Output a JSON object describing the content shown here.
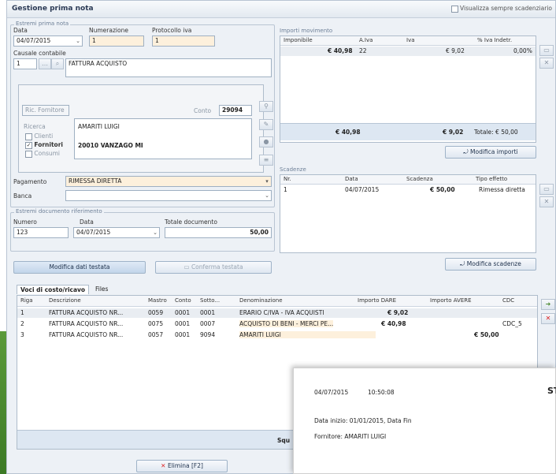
{
  "window": {
    "title": "Gestione prima nota",
    "show_due_dates_label": "Visualizza sempre scadenziario"
  },
  "header_group": {
    "legend": "Estremi prima nota",
    "date_label": "Data",
    "date_value": "04/07/2015",
    "numbering_label": "Numerazione",
    "numbering_value": "1",
    "vat_protocol_label": "Protocollo iva",
    "vat_protocol_value": "1",
    "causal_label": "Causale contabile",
    "causal_code": "1",
    "causal_desc": "FATTURA ACQUISTO"
  },
  "supplier": {
    "search_label": "Ric. Fornitore",
    "account_label": "Conto",
    "account_value": "29094",
    "search_group_label": "Ricerca",
    "filter_clients": "Clienti",
    "filter_suppliers": "Fornitori",
    "filter_consumers": "Consumi",
    "name": "AMARITI LUIGI",
    "address": "20010 VANZAGO  MI"
  },
  "payment": {
    "payment_label": "Pagamento",
    "payment_value": "RIMESSA DIRETTA",
    "bank_label": "Banca",
    "bank_value": ""
  },
  "document": {
    "legend": "Estremi documento riferimento",
    "number_label": "Numero",
    "number_value": "123",
    "date_label": "Data",
    "date_value": "04/07/2015",
    "total_label": "Totale documento",
    "total_value": "50,00"
  },
  "buttons": {
    "edit_header": "Modifica dati testata",
    "confirm_header": "Conferma testata",
    "edit_amounts": "Modifica importi",
    "edit_due_dates": "Modifica scadenze",
    "delete": "Elimina [F2]"
  },
  "amounts": {
    "legend": "Importi movimento",
    "columns": [
      "Imponibile",
      "A.Iva",
      "Iva",
      "% Iva Indetr."
    ],
    "row": {
      "taxable": "€ 40,98",
      "vat_code": "22",
      "vat": "€ 9,02",
      "nondeductible": "0,00%"
    },
    "total_taxable": "€ 40,98",
    "total_vat": "€ 9,02",
    "total_label": "Totale: € 50,00"
  },
  "due_dates": {
    "legend": "Scadenze",
    "columns": [
      "Nr.",
      "Data",
      "Scadenza",
      "Tipo effetto"
    ],
    "row": {
      "nr": "1",
      "date": "04/07/2015",
      "amount": "€ 50,00",
      "type": "Rimessa diretta"
    }
  },
  "tabs": [
    "Voci di costo/ricavo",
    "Files"
  ],
  "entries": {
    "columns": [
      "Riga",
      "Descrizione",
      "Mastro",
      "Conto",
      "Sotto...",
      "Denominazione",
      "Importo DARE",
      "Importo AVERE",
      "CDC"
    ],
    "rows": [
      {
        "riga": "1",
        "desc": "FATTURA ACQUISTO NR...",
        "mastro": "0059",
        "conto": "0001",
        "sotto": "0001",
        "denom": "ERARIO C/IVA - IVA ACQUISTI",
        "dare": "€ 9,02",
        "avere": "",
        "cdc": ""
      },
      {
        "riga": "2",
        "desc": "FATTURA ACQUISTO NR...",
        "mastro": "0075",
        "conto": "0001",
        "sotto": "0007",
        "denom": "ACQUISTO DI BENI - MERCI PE...",
        "dare": "€ 40,98",
        "avere": "",
        "cdc": "CDC_5"
      },
      {
        "riga": "3",
        "desc": "FATTURA ACQUISTO NR...",
        "mastro": "0057",
        "conto": "0001",
        "sotto": "9094",
        "denom": "AMARITI LUIGI",
        "dare": "",
        "avere": "€ 50,00",
        "cdc": ""
      }
    ],
    "footer_label": "Squ"
  },
  "popup": {
    "date": "04/07/2015",
    "time": "10:50:08",
    "corner": "ST",
    "range_line": "Data inizio: 01/01/2015, Data Fin",
    "supplier_line": "Fornitore: AMARITI LUIGI"
  },
  "colors": {
    "accent": "#2b3a55",
    "highlight": "#fdf0dc",
    "selected_row": "#e9edf2",
    "green": "#4e8b33",
    "red": "#d22"
  }
}
